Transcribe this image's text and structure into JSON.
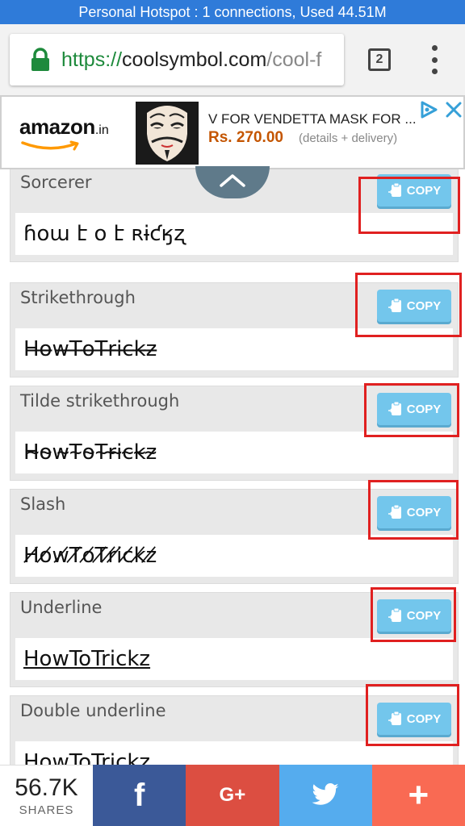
{
  "status_bar": {
    "text": "Personal Hotspot : 1 connections, Used 44.51M"
  },
  "browser": {
    "url_scheme": "https://",
    "url_domain": "coolsymbol.com",
    "url_path": "/cool-f",
    "tab_count": "2",
    "secure_color": "#1e8a3c"
  },
  "ad": {
    "brand": "amazon",
    "brand_suffix": ".in",
    "title": "V FOR VENDETTA MASK FOR ...",
    "price": "Rs. 270.00",
    "delivery": "(details + delivery)"
  },
  "copy_label": "COPY",
  "cards": [
    {
      "title": "Sorcerer",
      "sample": "ɦօա է օ է ʀɨƈӄʐ"
    },
    {
      "title": "Strikethrough",
      "sample": "H̶o̶w̶T̶o̶T̶r̶i̶c̶k̶z̶"
    },
    {
      "title": "Tilde strikethrough",
      "sample": "H̴o̴w̴T̴o̴T̴r̴i̴c̴k̴z̴"
    },
    {
      "title": "Slash",
      "sample": "H̸o̸w̸T̸o̸T̸r̸i̸c̸k̸z̸"
    },
    {
      "title": "Underline",
      "sample": "HowToTrickz"
    },
    {
      "title": "Double underline",
      "sample": "HowToTrickz"
    }
  ],
  "share": {
    "count": "56.7K",
    "label": "SHARES",
    "facebook_glyph": "f",
    "google_glyph": "G+",
    "more_glyph": "+"
  },
  "colors": {
    "hotspot": "#2f7bd9",
    "copy_button": "#73c6ec",
    "highlight": "#e02020",
    "facebook": "#3b5998",
    "google": "#dc4e41",
    "twitter": "#55acee",
    "more": "#f96a53"
  }
}
